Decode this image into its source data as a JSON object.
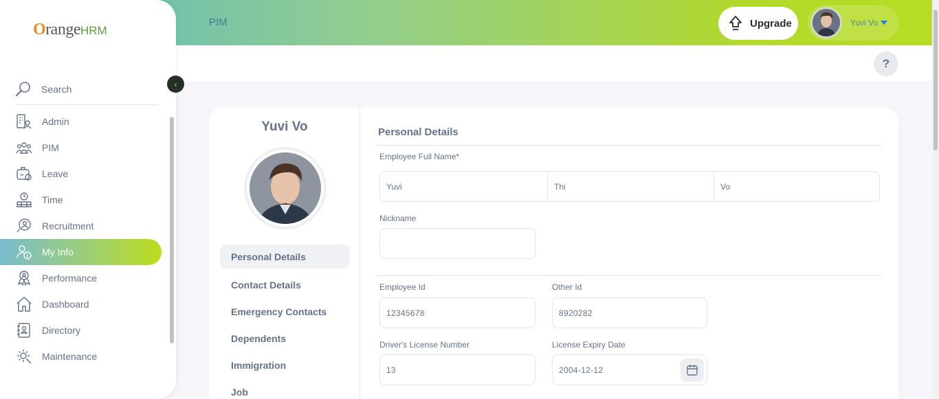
{
  "header": {
    "module": "PIM",
    "upgrade_label": "Upgrade",
    "user_name": "Yuvi Vo",
    "help_label": "?"
  },
  "sidebar": {
    "logo_o": "O",
    "logo_range": "range",
    "logo_hrm": "HRM",
    "search_label": "Search",
    "items": [
      {
        "label": "Admin",
        "icon": "admin-icon"
      },
      {
        "label": "PIM",
        "icon": "pim-icon"
      },
      {
        "label": "Leave",
        "icon": "leave-icon"
      },
      {
        "label": "Time",
        "icon": "time-icon"
      },
      {
        "label": "Recruitment",
        "icon": "recruitment-icon"
      },
      {
        "label": "My Info",
        "icon": "my-info-icon",
        "active": true
      },
      {
        "label": "Performance",
        "icon": "performance-icon"
      },
      {
        "label": "Dashboard",
        "icon": "dashboard-icon"
      },
      {
        "label": "Directory",
        "icon": "directory-icon"
      },
      {
        "label": "Maintenance",
        "icon": "maintenance-icon"
      }
    ]
  },
  "profile": {
    "name": "Yuvi Vo",
    "tabs": [
      {
        "label": "Personal Details",
        "active": true
      },
      {
        "label": "Contact Details"
      },
      {
        "label": "Emergency Contacts"
      },
      {
        "label": "Dependents"
      },
      {
        "label": "Immigration"
      },
      {
        "label": "Job"
      }
    ]
  },
  "form": {
    "title": "Personal Details",
    "full_name_label": "Employee Full Name*",
    "first_name": "Yuvi",
    "middle_name": "Thi",
    "last_name": "Vo",
    "nickname_label": "Nickname",
    "nickname": "",
    "employee_id_label": "Employee Id",
    "employee_id": "12345678",
    "other_id_label": "Other Id",
    "other_id": "8920282",
    "license_label": "Driver's License Number",
    "license": "13",
    "expiry_label": "License Expiry Date",
    "expiry": "2004-12-12"
  },
  "colors": {
    "accent_orange": "#ff7b1d",
    "active_gradient_start": "#78bccd",
    "active_gradient_end": "#bcdc1a"
  }
}
